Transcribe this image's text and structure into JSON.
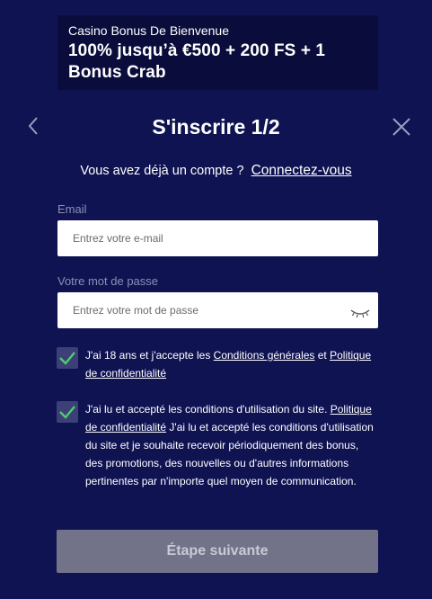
{
  "banner": {
    "subtitle": "Casino Bonus De Bienvenue",
    "title": "100% jusqu’à €500 + 200 FS + 1 Bonus Crab"
  },
  "header": {
    "title": "S'inscrire 1/2",
    "back_icon": "chevron-left-icon",
    "close_icon": "close-icon"
  },
  "login": {
    "prompt": "Vous avez déjà un compte ?",
    "link": "Connectez-vous"
  },
  "email": {
    "label": "Email",
    "placeholder": "Entrez votre e-mail",
    "value": ""
  },
  "password": {
    "label": "Votre mot de passe",
    "placeholder": "Entrez votre mot de passe",
    "value": "",
    "toggle_icon": "eye-closed-icon"
  },
  "consents": [
    {
      "checked": true,
      "text_before": "J'ai 18 ans et j'accepte les ",
      "link1": "Conditions générales",
      "text_middle": " et ",
      "link2": "Politique de confidentialité",
      "text_after": ""
    },
    {
      "checked": true,
      "text_before": "J'ai lu et accepté les conditions d'utilisation du site. ",
      "link1": "Politique de confidentialité",
      "text_after": " J'ai lu et accepté les conditions d'utilisation du site et je souhaite recevoir périodiquement des bonus, des promotions, des nouvelles ou d'autres informations pertinentes par n'importe quel moyen de communication."
    }
  ],
  "next_button": {
    "label": "Étape suivante"
  },
  "colors": {
    "background": "#0f1352",
    "banner": "#0a0d3b",
    "checkbox": "#3c4077",
    "check": "#4ecb71",
    "button_disabled": "#727289",
    "label": "#8b8fb5"
  }
}
